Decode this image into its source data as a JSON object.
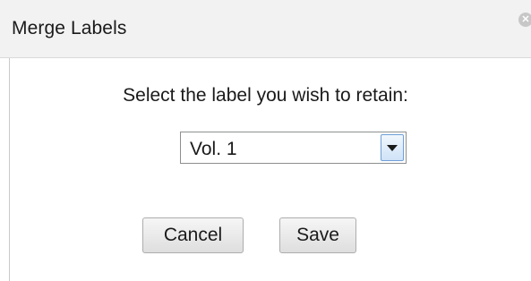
{
  "dialog": {
    "title": "Merge Labels",
    "close_glyph": "✕",
    "prompt": "Select the label you wish to retain:",
    "select": {
      "value": "Vol. 1"
    },
    "buttons": {
      "cancel": "Cancel",
      "save": "Save"
    }
  },
  "icons": {
    "close": "close-icon",
    "dropdown": "chevron-down-icon"
  },
  "colors": {
    "titlebar_bg": "#f2f2f2",
    "dropdown_accent": "#6f9fd6"
  }
}
